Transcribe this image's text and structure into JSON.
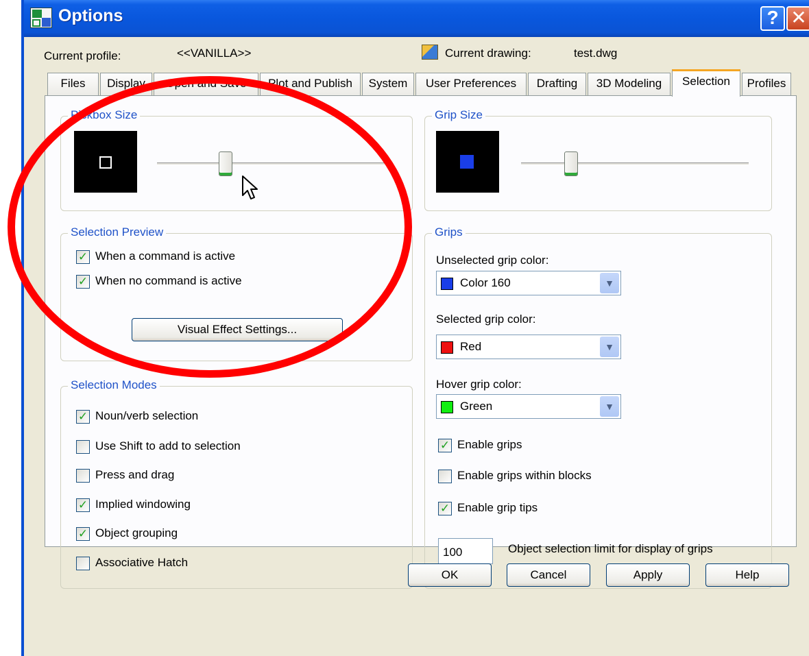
{
  "window": {
    "title": "Options"
  },
  "profile": {
    "current_profile_label": "Current profile:",
    "current_profile_value": "<<VANILLA>>",
    "current_drawing_label": "Current drawing:",
    "current_drawing_value": "test.dwg"
  },
  "tabs": [
    {
      "label": "Files"
    },
    {
      "label": "Display"
    },
    {
      "label": "Open and Save"
    },
    {
      "label": "Plot and Publish"
    },
    {
      "label": "System"
    },
    {
      "label": "User Preferences"
    },
    {
      "label": "Drafting"
    },
    {
      "label": "3D Modeling"
    },
    {
      "label": "Selection"
    },
    {
      "label": "Profiles"
    }
  ],
  "active_tab": "Selection",
  "pickbox": {
    "title": "Pickbox Size",
    "slider_level": 0.3
  },
  "grip_size": {
    "title": "Grip Size",
    "slider_level": 0.22,
    "swatch_color": "#1a3ee8"
  },
  "selection_preview": {
    "title": "Selection Preview",
    "options": [
      {
        "label": "When a command is active",
        "checked": true
      },
      {
        "label": "When no command is active",
        "checked": true
      }
    ],
    "button_label": "Visual Effect Settings..."
  },
  "selection_modes": {
    "title": "Selection Modes",
    "options": [
      {
        "label": "Noun/verb selection",
        "checked": true
      },
      {
        "label": "Use Shift to add to selection",
        "checked": false
      },
      {
        "label": "Press and drag",
        "checked": false
      },
      {
        "label": "Implied windowing",
        "checked": true
      },
      {
        "label": "Object grouping",
        "checked": true
      },
      {
        "label": "Associative Hatch",
        "checked": false
      }
    ]
  },
  "grips": {
    "title": "Grips",
    "unselected_label": "Unselected grip color:",
    "unselected_value": "Color 160",
    "unselected_color": "#1a3ee8",
    "selected_label": "Selected grip color:",
    "selected_value": "Red",
    "selected_color": "#ee1111",
    "hover_label": "Hover grip color:",
    "hover_value": "Green",
    "hover_color": "#11ee11",
    "options": [
      {
        "label": "Enable grips",
        "checked": true
      },
      {
        "label": "Enable grips within blocks",
        "checked": false
      },
      {
        "label": "Enable grip tips",
        "checked": true
      }
    ],
    "limit_value": "100",
    "limit_label": "Object selection limit for display of grips"
  },
  "buttons": {
    "ok": "OK",
    "cancel": "Cancel",
    "apply": "Apply",
    "help": "Help"
  },
  "icons": {
    "help": "help-icon",
    "close": "close-icon",
    "dropdown": "chevron-down-icon"
  },
  "annotation_color": "#ff0000"
}
